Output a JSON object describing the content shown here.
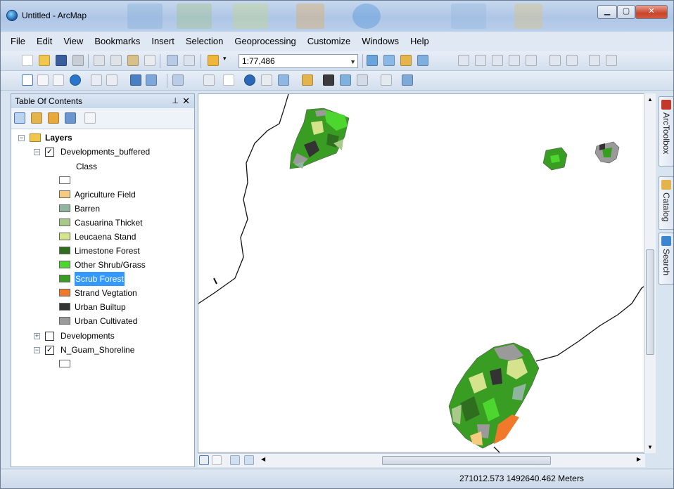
{
  "window": {
    "title": "Untitled - ArcMap"
  },
  "menu": [
    "File",
    "Edit",
    "View",
    "Bookmarks",
    "Insert",
    "Selection",
    "Geoprocessing",
    "Customize",
    "Windows",
    "Help"
  ],
  "toolbar": {
    "scale": "1:77,486"
  },
  "toc": {
    "title": "Table Of Contents",
    "root": "Layers",
    "layer1": {
      "name": "Developments_buffered",
      "checked": true,
      "field": "Class"
    },
    "legend": [
      {
        "label": "",
        "color": "#ffffff"
      },
      {
        "label": "Agriculture Field",
        "color": "#f5cc7f"
      },
      {
        "label": "Barren",
        "color": "#8fb59f"
      },
      {
        "label": "Casuarina Thicket",
        "color": "#a9c98a"
      },
      {
        "label": "Leucaena Stand",
        "color": "#d4e38c"
      },
      {
        "label": "Limestone Forest",
        "color": "#2f6e1e"
      },
      {
        "label": "Other Shrub/Grass",
        "color": "#4cd62e"
      },
      {
        "label": "Scrub Forest",
        "color": "#3a9d23"
      },
      {
        "label": "Strand Vegtation",
        "color": "#f07a2a"
      },
      {
        "label": "Urban Builtup",
        "color": "#333333"
      },
      {
        "label": "Urban Cultivated",
        "color": "#9a9a9a"
      }
    ],
    "selected_legend": "Scrub Forest",
    "layer2": {
      "name": "Developments",
      "checked": false
    },
    "layer3": {
      "name": "N_Guam_Shoreline",
      "checked": true
    }
  },
  "dock": {
    "tabs": [
      "ArcToolbox",
      "Catalog",
      "Search"
    ]
  },
  "status": {
    "coordinates": "271012.573  1492640.462 Meters"
  },
  "colors": {
    "accent": "#3399ff",
    "shoreline": "#111111"
  }
}
